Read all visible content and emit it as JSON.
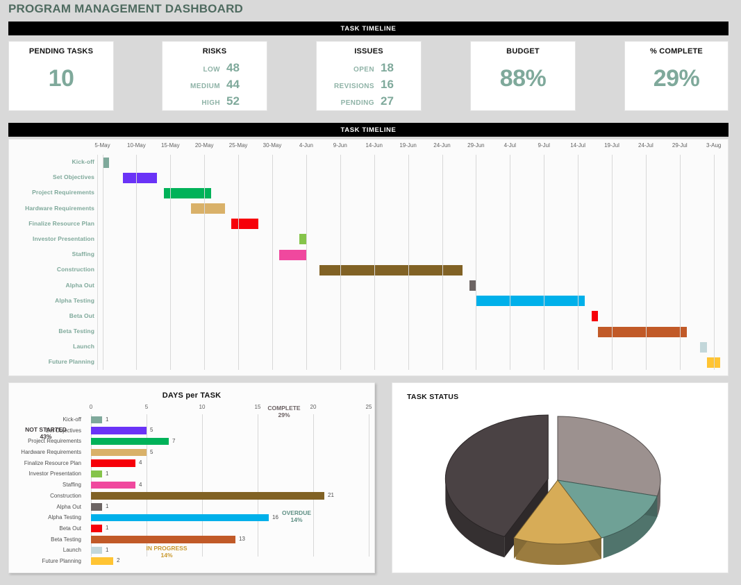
{
  "page": {
    "title": "PROGRAM MANAGEMENT DASHBOARD"
  },
  "banners": {
    "top": "TASK TIMELINE",
    "gantt": "TASK TIMELINE"
  },
  "accent": {
    "teal": "#7FA99B",
    "teal_light": "#8FB3A7",
    "black": "#000000"
  },
  "kpis": [
    {
      "title": "PENDING TASKS",
      "big": "10"
    },
    {
      "title": "RISKS",
      "rows": [
        {
          "label": "LOW",
          "value": "48"
        },
        {
          "label": "MEDIUM",
          "value": "44"
        },
        {
          "label": "HIGH",
          "value": "52"
        }
      ]
    },
    {
      "title": "ISSUES",
      "rows": [
        {
          "label": "OPEN",
          "value": "18"
        },
        {
          "label": "REVISIONS",
          "value": "16"
        },
        {
          "label": "PENDING",
          "value": "27"
        }
      ]
    },
    {
      "title": "BUDGET",
      "big": "88%"
    },
    {
      "title": "% COMPLETE",
      "big": "29%"
    }
  ],
  "chart_data": [
    {
      "type": "bar",
      "name": "gantt-timeline",
      "title": "TASK TIMELINE",
      "orientation": "horizontal-time",
      "xlabel": "",
      "ylabel": "",
      "axis_ticks": [
        "5-May",
        "10-May",
        "15-May",
        "20-May",
        "25-May",
        "30-May",
        "4-Jun",
        "9-Jun",
        "14-Jun",
        "19-Jun",
        "24-Jun",
        "29-Jun",
        "4-Jul",
        "9-Jul",
        "14-Jul",
        "19-Jul",
        "24-Jul",
        "29-Jul",
        "3-Aug"
      ],
      "axis_range_days": [
        0,
        90
      ],
      "grid": true,
      "categories": [
        "Kick-off",
        "Set Objectives",
        "Project Requirements",
        "Hardware Requirements",
        "Finalize Resource Plan",
        "Investor Presentation",
        "Staffing",
        "Construction",
        "Alpha Out",
        "Alpha Testing",
        "Beta Out",
        "Beta Testing",
        "Launch",
        "Future Planning"
      ],
      "tasks": [
        {
          "task": "Kick-off",
          "start_day": 0,
          "duration": 1,
          "color": "#7FA99B"
        },
        {
          "task": "Set Objectives",
          "start_day": 3,
          "duration": 5,
          "color": "#6A33F7"
        },
        {
          "task": "Project Requirements",
          "start_day": 9,
          "duration": 7,
          "color": "#00B259"
        },
        {
          "task": "Hardware Requirements",
          "start_day": 13,
          "duration": 5,
          "color": "#D9B169"
        },
        {
          "task": "Finalize Resource Plan",
          "start_day": 19,
          "duration": 4,
          "color": "#F60009"
        },
        {
          "task": "Investor Presentation",
          "start_day": 29,
          "duration": 1,
          "color": "#85C44A"
        },
        {
          "task": "Staffing",
          "start_day": 26,
          "duration": 4,
          "color": "#F0489E"
        },
        {
          "task": "Construction",
          "start_day": 32,
          "duration": 21,
          "color": "#816225"
        },
        {
          "task": "Alpha Out",
          "start_day": 54,
          "duration": 1,
          "color": "#6C6463"
        },
        {
          "task": "Alpha Testing",
          "start_day": 55,
          "duration": 16,
          "color": "#00B0EA"
        },
        {
          "task": "Beta Out",
          "start_day": 72,
          "duration": 1,
          "color": "#F60009"
        },
        {
          "task": "Beta Testing",
          "start_day": 73,
          "duration": 13,
          "color": "#C15A28"
        },
        {
          "task": "Launch",
          "start_day": 88,
          "duration": 1,
          "color": "#C3D7DA"
        },
        {
          "task": "Future Planning",
          "start_day": 89,
          "duration": 2,
          "color": "#FFC433"
        }
      ]
    },
    {
      "type": "bar",
      "name": "days-per-task",
      "title": "DAYS per TASK",
      "orientation": "horizontal",
      "xlabel": "",
      "ylabel": "",
      "xlim": [
        0,
        25
      ],
      "xticks": [
        "0",
        "5",
        "10",
        "15",
        "20",
        "25"
      ],
      "grid": true,
      "categories": [
        "Kick-off",
        "Set Objectives",
        "Project Requirements",
        "Hardware Requirements",
        "Finalize Resource Plan",
        "Investor Presentation",
        "Staffing",
        "Construction",
        "Alpha Out",
        "Alpha Testing",
        "Beta Out",
        "Beta Testing",
        "Launch",
        "Future Planning"
      ],
      "values": [
        1,
        5,
        7,
        5,
        4,
        1,
        4,
        21,
        1,
        16,
        1,
        13,
        1,
        2
      ],
      "colors": [
        "#7FA99B",
        "#6A33F7",
        "#00B259",
        "#D9B169",
        "#F60009",
        "#85C44A",
        "#F0489E",
        "#816225",
        "#6C6463",
        "#00B0EA",
        "#F60009",
        "#C15A28",
        "#C3D7DA",
        "#FFC433"
      ]
    },
    {
      "type": "pie",
      "name": "task-status",
      "title": "TASK STATUS",
      "labels": [
        "NOT STARTED",
        "COMPLETE",
        "OVERDUE",
        "IN PROGRESS"
      ],
      "values": [
        43,
        29,
        14,
        14
      ],
      "value_labels": [
        "43%",
        "29%",
        "14%",
        "14%"
      ],
      "colors": [
        "#4A4244",
        "#9C918F",
        "#6FA196",
        "#D7AC57"
      ],
      "exploded": [
        "NOT STARTED"
      ],
      "legend": "labels-outside",
      "three_d": true
    }
  ]
}
